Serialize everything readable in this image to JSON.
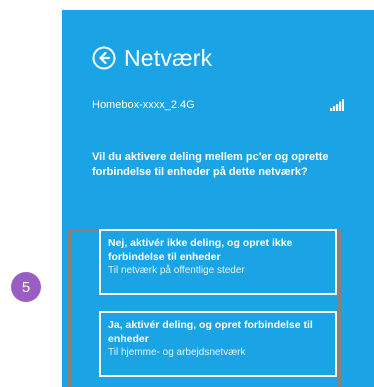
{
  "header": {
    "back_icon": "back-arrow-circle-icon",
    "title": "Netværk"
  },
  "network": {
    "name": "Homebox-xxxx_2.4G",
    "signal_icon": "wifi-signal-bars-icon"
  },
  "prompt": {
    "question": "Vil du aktivere deling mellem pc'er og oprette forbindelse til enheder på dette netværk?"
  },
  "options": [
    {
      "title": "Nej, aktivér ikke deling, og opret ikke forbindelse til enheder",
      "subtitle": "Til netværk på offentlige steder"
    },
    {
      "title": "Ja, aktivér deling, og opret forbindelse til enheder",
      "subtitle": "Til hjemme- og arbejdsnetværk"
    }
  ],
  "step_badge": {
    "number": "5"
  },
  "colors": {
    "panel": "#1aa4e6",
    "badge": "#9a5dc4",
    "frame": "#8b7f7a",
    "text": "#ffffff"
  }
}
